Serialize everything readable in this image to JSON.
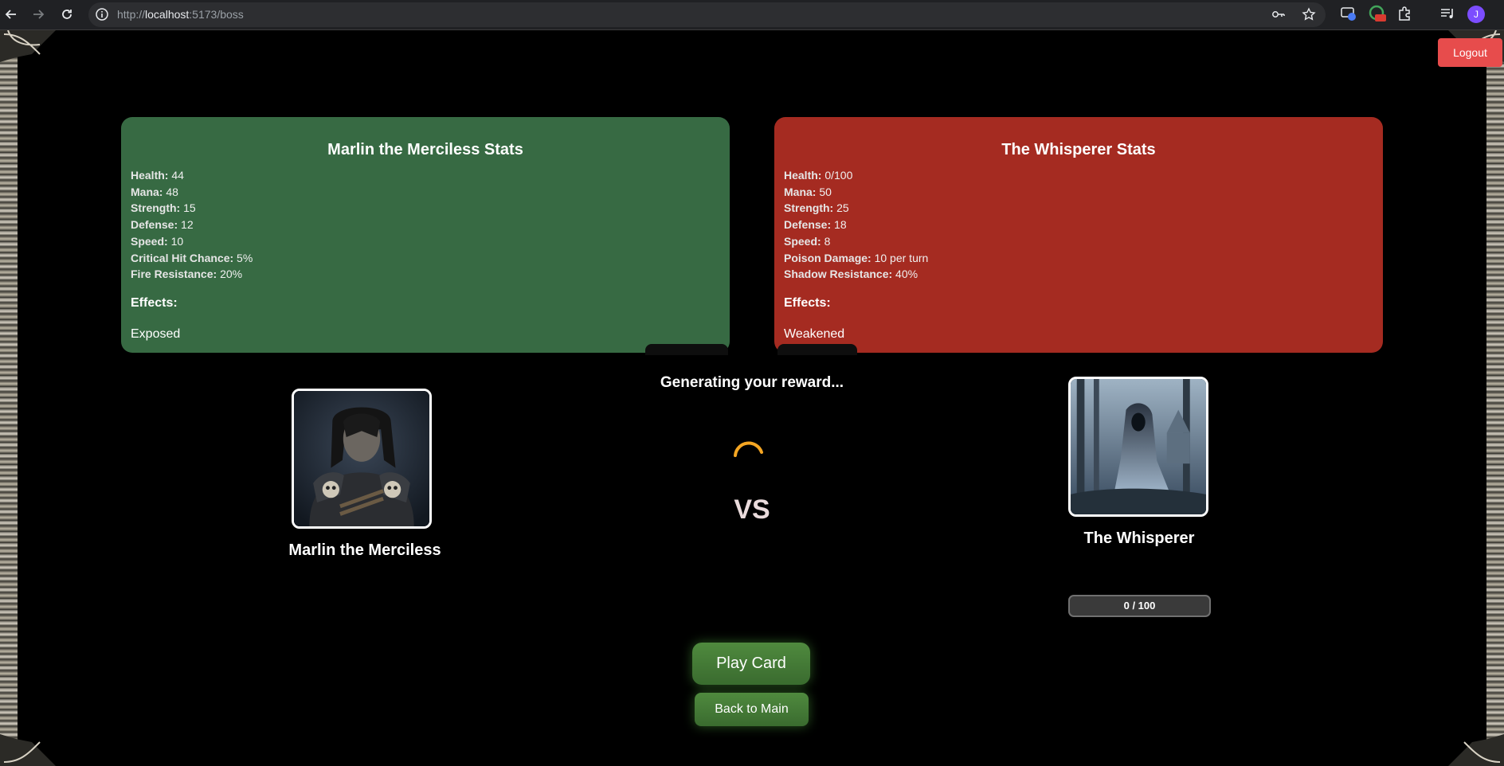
{
  "browser": {
    "url_scheme": "http://",
    "url_host": "localhost",
    "url_rest": ":5173/boss",
    "profile_initial": "J",
    "extension_badge": "off"
  },
  "header": {
    "logout_label": "Logout"
  },
  "player": {
    "stats_title": "Marlin the Merciless Stats",
    "name": "Marlin the Merciless",
    "stats": [
      {
        "label": "Health:",
        "value": "44"
      },
      {
        "label": "Mana:",
        "value": "48"
      },
      {
        "label": "Strength:",
        "value": "15"
      },
      {
        "label": "Defense:",
        "value": "12"
      },
      {
        "label": "Speed:",
        "value": "10"
      },
      {
        "label": "Critical Hit Chance:",
        "value": "5%"
      },
      {
        "label": "Fire Resistance:",
        "value": "20%"
      }
    ],
    "effects_label": "Effects:",
    "effects": [
      "Exposed"
    ],
    "panel_color": "#376a43"
  },
  "boss": {
    "stats_title": "The Whisperer Stats",
    "name": "The Whisperer",
    "stats": [
      {
        "label": "Health:",
        "value": "0/100"
      },
      {
        "label": "Mana:",
        "value": "50"
      },
      {
        "label": "Strength:",
        "value": "25"
      },
      {
        "label": "Defense:",
        "value": "18"
      },
      {
        "label": "Speed:",
        "value": "8"
      },
      {
        "label": "Poison Damage:",
        "value": "10 per turn"
      },
      {
        "label": "Shadow Resistance:",
        "value": "40%"
      }
    ],
    "effects_label": "Effects:",
    "effects": [
      "Weakened"
    ],
    "health_bar": "0 / 100",
    "health_fraction": 0,
    "panel_color": "#a52b21"
  },
  "battle": {
    "status_text": "Generating your reward...",
    "vs_text": "VS",
    "spinner_color": "#f5a623"
  },
  "actions": {
    "play_card_label": "Play Card",
    "back_label": "Back to Main"
  }
}
